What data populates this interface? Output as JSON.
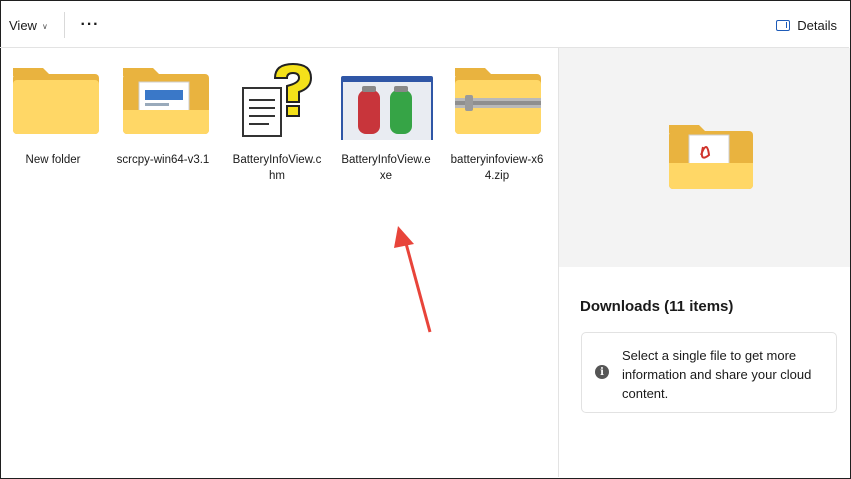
{
  "toolbar": {
    "view_label": "View",
    "more_label": "···",
    "details_label": "Details"
  },
  "files": [
    {
      "name": "New folder",
      "icon": "folder-icon"
    },
    {
      "name": "scrcpy-win64-v3.1",
      "icon": "folder-with-content-icon"
    },
    {
      "name": "BatteryInfoView.chm",
      "icon": "help-file-icon"
    },
    {
      "name": "BatteryInfoView.exe",
      "icon": "battery-app-icon"
    },
    {
      "name": "batteryinfoview-x64.zip",
      "icon": "zip-folder-icon"
    }
  ],
  "details_pane": {
    "title": "Downloads (11 items)",
    "info_text": "Select a single file to get more information and share your cloud content.",
    "preview_icon": "downloads-folder-pdf-icon"
  },
  "colors": {
    "folder_light": "#ffd766",
    "folder_dark": "#e9b33f",
    "accent_blue": "#1e5bb8",
    "annotation_red": "#e8443a"
  }
}
